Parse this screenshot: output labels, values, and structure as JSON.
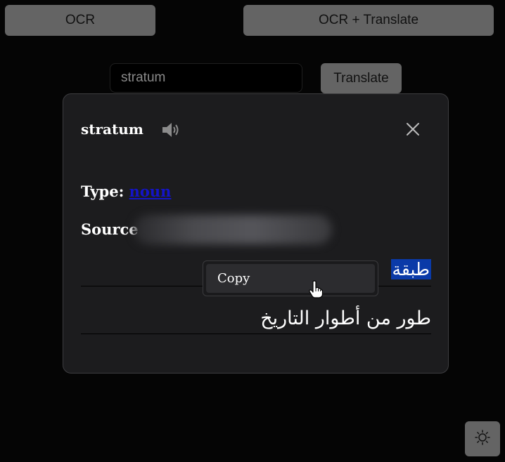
{
  "toolbar": {
    "ocr_label": "OCR",
    "ocr_translate_label": "OCR + Translate"
  },
  "search": {
    "value": "stratum",
    "translate_label": "Translate"
  },
  "dialog": {
    "word": "stratum",
    "type_label": "Type:",
    "type_value": "noun",
    "source_label": "Source",
    "translation_primary": "طبقة",
    "translation_secondary": "طور من أطوار التاريخ"
  },
  "context_menu": {
    "copy_label": "Copy"
  },
  "colors": {
    "background": "#050505",
    "button": "#646464",
    "dialog_bg": "#1c1c1e",
    "link": "#1414c8",
    "selection": "#0a3aa8"
  },
  "icons": {
    "speaker": "speaker-icon",
    "close": "close-icon",
    "theme": "sun-icon",
    "cursor": "hand-pointer-icon"
  }
}
